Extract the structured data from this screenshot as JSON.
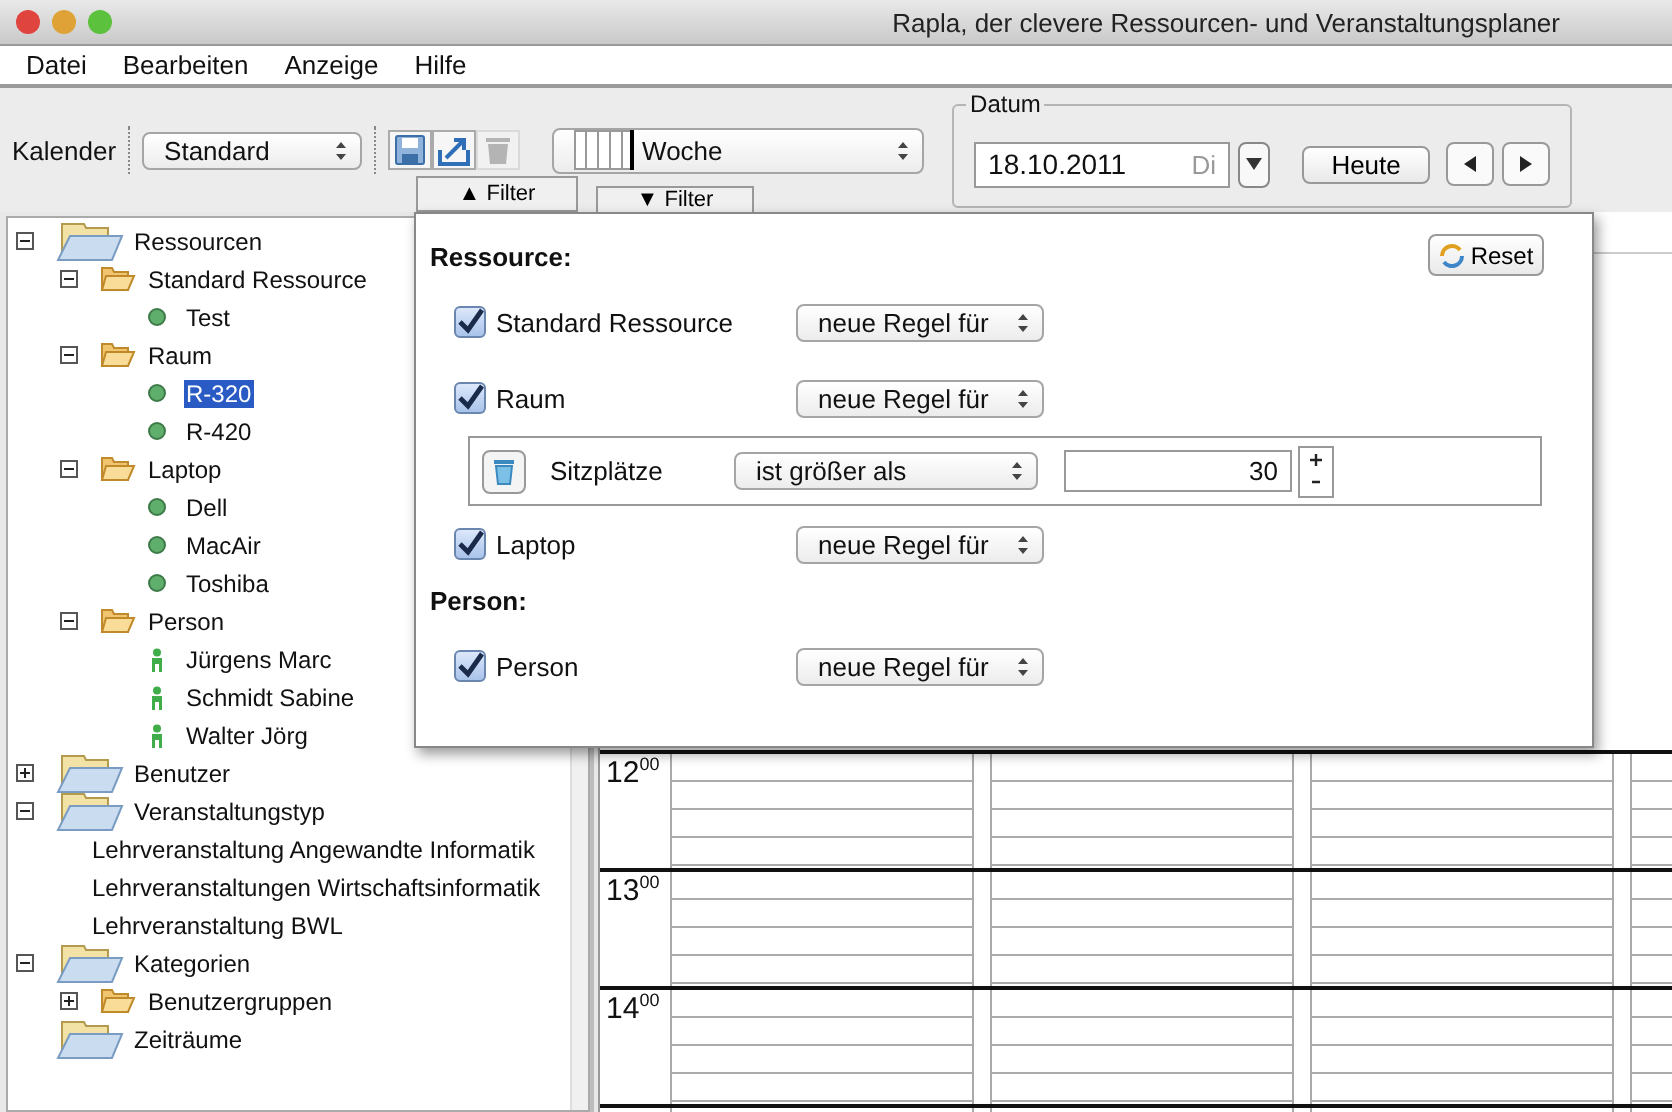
{
  "window": {
    "title": "Rapla, der clevere Ressourcen- und Veranstaltungsplaner"
  },
  "menu": [
    "Datei",
    "Bearbeiten",
    "Anzeige",
    "Hilfe"
  ],
  "toolbar": {
    "calendar_label": "Kalender",
    "calendar_select": "Standard",
    "save_disabled": false,
    "export_disabled": false,
    "delete_disabled": true,
    "view_select": "Woche",
    "date_group": {
      "title": "Datum",
      "date": "18.10.2011",
      "weekday": "Di",
      "today": "Heute"
    }
  },
  "tree_filter": {
    "glyph": "▲",
    "label": "Filter"
  },
  "calendar_filter": {
    "glyph": "▼",
    "label": "Filter"
  },
  "tree": [
    {
      "kind": "category",
      "label": "Ressourcen",
      "expanded": true,
      "selected": false,
      "children": [
        {
          "kind": "folder",
          "label": "Standard Ressource",
          "expanded": true,
          "selected": false,
          "children": [
            {
              "kind": "resource",
              "label": "Test",
              "selected": false
            }
          ]
        },
        {
          "kind": "folder",
          "label": "Raum",
          "expanded": true,
          "selected": false,
          "children": [
            {
              "kind": "resource",
              "label": "R-320",
              "selected": true
            },
            {
              "kind": "resource",
              "label": "R-420",
              "selected": false
            }
          ]
        },
        {
          "kind": "folder",
          "label": "Laptop",
          "expanded": true,
          "selected": false,
          "children": [
            {
              "kind": "resource",
              "label": "Dell",
              "selected": false
            },
            {
              "kind": "resource",
              "label": "MacAir",
              "selected": false
            },
            {
              "kind": "resource",
              "label": "Toshiba",
              "selected": false
            }
          ]
        },
        {
          "kind": "folder",
          "label": "Person",
          "expanded": true,
          "selected": false,
          "children": [
            {
              "kind": "person",
              "label": "Jürgens Marc",
              "selected": false
            },
            {
              "kind": "person",
              "label": "Schmidt Sabine",
              "selected": false
            },
            {
              "kind": "person",
              "label": "Walter Jörg",
              "selected": false
            }
          ]
        }
      ]
    },
    {
      "kind": "category",
      "label": "Benutzer",
      "expanded": false,
      "selected": false
    },
    {
      "kind": "category",
      "label": "Veranstaltungstyp",
      "expanded": true,
      "selected": false,
      "children": [
        {
          "kind": "type",
          "label": "Lehrveranstaltung Angewandte Informatik",
          "selected": false
        },
        {
          "kind": "type",
          "label": "Lehrveranstaltungen Wirtschaftsinformatik",
          "selected": false
        },
        {
          "kind": "type",
          "label": "Lehrveranstaltung BWL",
          "selected": false
        }
      ]
    },
    {
      "kind": "category",
      "label": "Kategorien",
      "expanded": true,
      "selected": false,
      "children": [
        {
          "kind": "folder",
          "label": "Benutzergruppen",
          "expanded": false,
          "selected": false
        }
      ]
    },
    {
      "kind": "category",
      "label": "Zeiträume",
      "selected": false
    }
  ],
  "calendar": {
    "hours": [
      {
        "hour": "12",
        "minutes": "00"
      },
      {
        "hour": "13",
        "minutes": "00"
      },
      {
        "hour": "14",
        "minutes": "00"
      }
    ]
  },
  "filter_popup": {
    "reset": "Reset",
    "sections": [
      {
        "title": "Ressource:",
        "rows": [
          {
            "label": "Standard Ressource",
            "checked": true,
            "rule_select": "neue Regel für"
          },
          {
            "label": "Raum",
            "checked": true,
            "rule_select": "neue Regel für",
            "rules": [
              {
                "attribute": "Sitzplätze",
                "operator": "ist größer als",
                "value": "30"
              }
            ]
          },
          {
            "label": "Laptop",
            "checked": true,
            "rule_select": "neue Regel für"
          }
        ]
      },
      {
        "title": "Person:",
        "rows": [
          {
            "label": "Person",
            "checked": true,
            "rule_select": "neue Regel für"
          }
        ]
      }
    ]
  }
}
